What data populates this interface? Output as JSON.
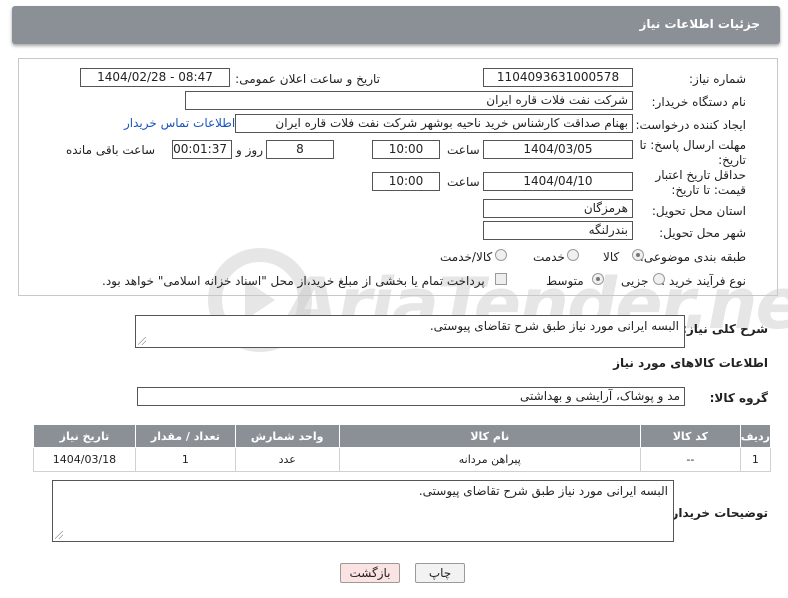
{
  "header": {
    "title": "جزئیات اطلاعات نیاز"
  },
  "watermark": {
    "text": "AriaTender.neT"
  },
  "fields": {
    "need_number": {
      "label": "شماره نیاز:",
      "value": "1104093631000578"
    },
    "announce_datetime": {
      "label": "تاریخ و ساعت اعلان عمومی:",
      "value": "1404/02/28 - 08:47"
    },
    "buyer_org": {
      "label": "نام دستگاه خریدار:",
      "value": "شرکت نفت فلات قاره ایران"
    },
    "requester": {
      "label": "ایجاد کننده درخواست:",
      "value": "بهنام  صداقت کارشناس خرید ناحیه بوشهر شرکت نفت فلات قاره ایران"
    },
    "buyer_contact_link": "اطلاعات تماس خریدار",
    "reply_deadline": {
      "label": "مهلت ارسال پاسخ: تا تاریخ:",
      "date": "1404/03/05",
      "time_label": "ساعت",
      "time": "10:00",
      "days": "8",
      "days_label": "روز و",
      "remaining": "00:01:37",
      "remaining_label": "ساعت باقی مانده"
    },
    "price_validity": {
      "label": "حداقل تاریخ اعتبار قیمت: تا تاریخ:",
      "date": "1404/04/10",
      "time_label": "ساعت",
      "time": "10:00"
    },
    "delivery_province": {
      "label": "استان محل تحویل:",
      "value": "هرمزگان"
    },
    "delivery_city": {
      "label": "شهر محل تحویل:",
      "value": "بندرلنگه"
    },
    "category": {
      "label": "طبقه بندی موضوعی:",
      "options": [
        "کالا",
        "خدمت",
        "کالا/خدمت"
      ],
      "selected": "کالا"
    },
    "purchase_type": {
      "label": "نوع فرآیند خرید :",
      "options": [
        "جزیی",
        "متوسط"
      ],
      "selected": "متوسط",
      "payment_note": "پرداخت تمام یا بخشی از مبلغ خرید،از محل \"اسناد خزانه اسلامی\" خواهد بود."
    }
  },
  "description": {
    "label": "شرح کلی نیاز:",
    "value": "البسه ایرانی مورد نیاز طبق شرح تقاضای پیوستی."
  },
  "items_section": {
    "title": "اطلاعات کالاهای مورد نیاز",
    "group_label": "گروه کالا:",
    "group_value": "مد و پوشاک، آرایشی و بهداشتی",
    "columns": [
      "ردیف",
      "کد کالا",
      "نام کالا",
      "واحد شمارش",
      "تعداد / مقدار",
      "تاریخ نیاز"
    ],
    "rows": [
      [
        "1",
        "--",
        "پیراهن مردانه",
        "عدد",
        "1",
        "1404/03/18"
      ]
    ]
  },
  "buyer_notes": {
    "label": "توضیحات خریدار:",
    "value": "البسه ایرانی مورد نیاز طبق شرح تقاضای پیوستی."
  },
  "buttons": {
    "print": "چاپ",
    "back": "بازگشت"
  },
  "colors": {
    "header_bg": "#8b8f96",
    "link": "#1a55c0",
    "back_button_bg": "#fbe3e3"
  }
}
